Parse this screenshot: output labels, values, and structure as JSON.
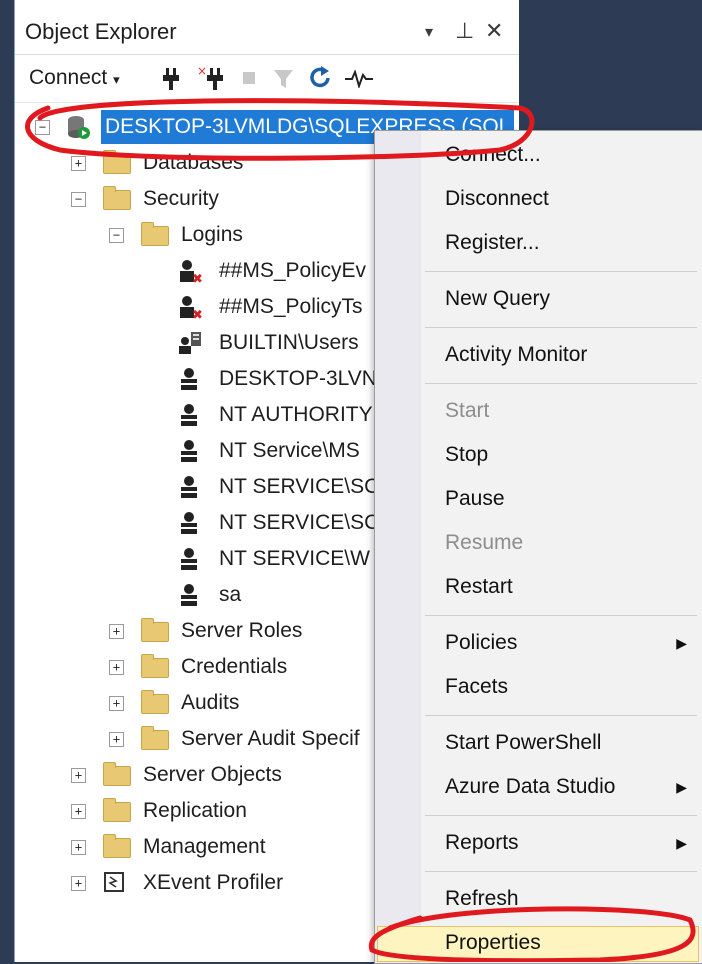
{
  "panel": {
    "title": "Object Explorer",
    "controls": {
      "dropdown": "▾",
      "pin": "⊥",
      "close": "✕"
    }
  },
  "toolbar": {
    "connect_label": "Connect",
    "connect_arrow": "▾"
  },
  "tree": {
    "server": "DESKTOP-3LVMLDG\\SQLEXPRESS (SQL",
    "databases": "Databases",
    "security": "Security",
    "logins": "Logins",
    "login_items": [
      "##MS_PolicyEv",
      "##MS_PolicyTs",
      "BUILTIN\\Users",
      "DESKTOP-3LVN",
      "NT AUTHORITY",
      "NT Service\\MS",
      "NT SERVICE\\SC",
      "NT SERVICE\\SC",
      "NT SERVICE\\W",
      "sa"
    ],
    "server_roles": "Server Roles",
    "credentials": "Credentials",
    "audits": "Audits",
    "server_audit_spec": "Server Audit Specif",
    "server_objects": "Server Objects",
    "replication": "Replication",
    "management": "Management",
    "xevent_profiler": "XEvent Profiler"
  },
  "context_menu": {
    "connect": "Connect...",
    "disconnect": "Disconnect",
    "register": "Register...",
    "new_query": "New Query",
    "activity_monitor": "Activity Monitor",
    "start": "Start",
    "stop": "Stop",
    "pause": "Pause",
    "resume": "Resume",
    "restart": "Restart",
    "policies": "Policies",
    "facets": "Facets",
    "start_powershell": "Start PowerShell",
    "azure_data_studio": "Azure Data Studio",
    "reports": "Reports",
    "refresh": "Refresh",
    "properties": "Properties",
    "submenu_arrow": "▶"
  },
  "colors": {
    "selection": "#1f7bd6",
    "highlight": "#fdf4bf",
    "annotation": "#e0191f",
    "background": "#2d3b55"
  }
}
